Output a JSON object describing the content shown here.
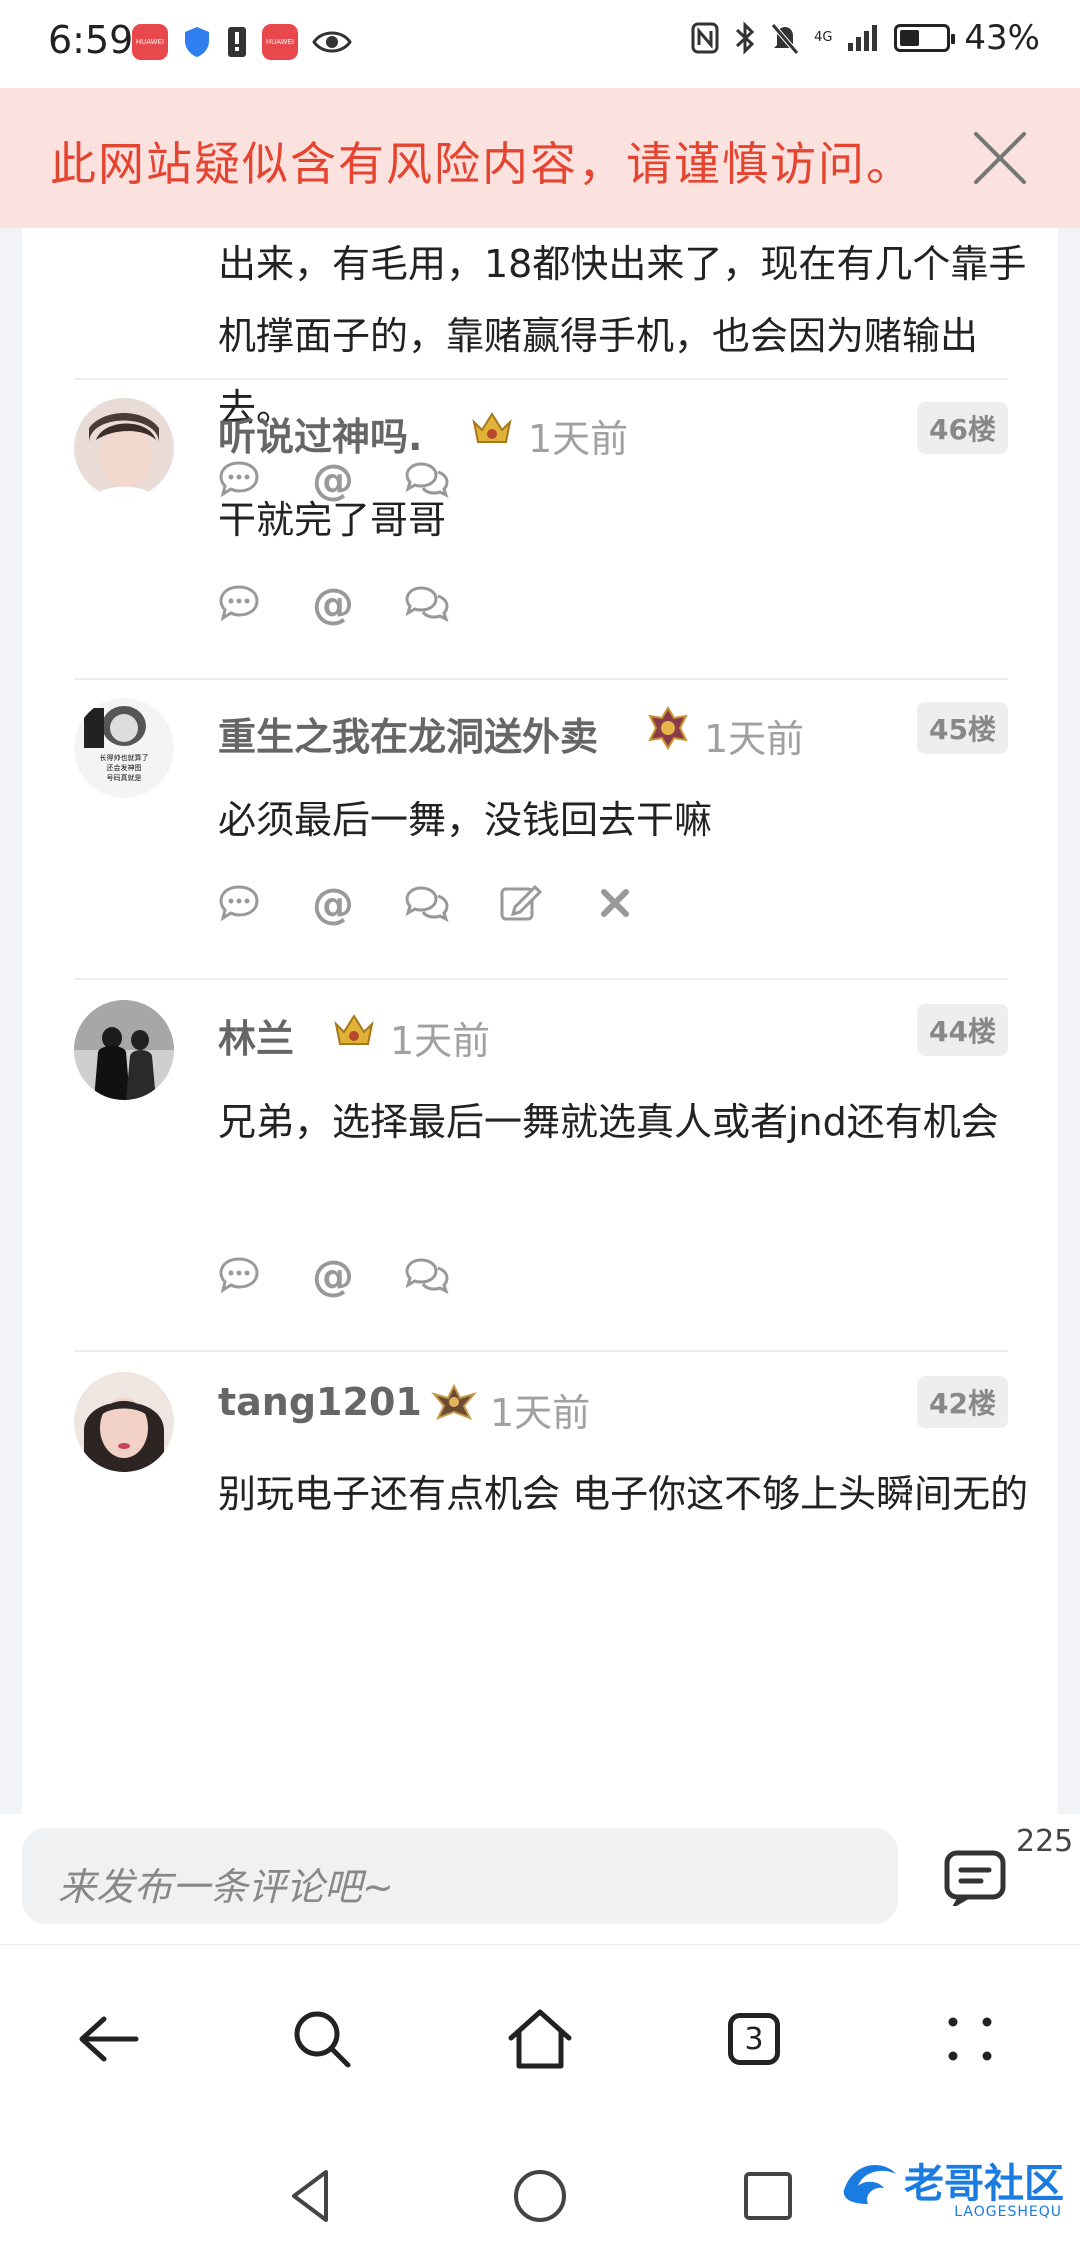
{
  "status_bar": {
    "time": "6:59",
    "battery": "43%",
    "battery_level": 0.43,
    "huawei_label": "HUAWEI",
    "network_label": "4G"
  },
  "warning": {
    "text": "此网站疑似含有风险内容，请谨慎访问。"
  },
  "prev_comment": {
    "text": "出来，有毛用，18都快出来了，现在有几个靠手机撑面子的，靠赌赢得手机，也会因为赌输出去。"
  },
  "comments": [
    {
      "username": "听说过神吗.",
      "time": "1天前",
      "floor": "46楼",
      "text": "干就完了哥哥"
    },
    {
      "username": "重生之我在龙洞送外卖",
      "time": "1天前",
      "floor": "45楼",
      "text": "必须最后一舞，没钱回去干嘛",
      "avatar_text": "长得帅也就算了 还会发神图 号码真就是"
    },
    {
      "username": "林兰",
      "time": "1天前",
      "floor": "44楼",
      "text": "兄弟，选择最后一舞就选真人或者jnd还有机会"
    },
    {
      "username": "tang1201",
      "time": "1天前",
      "floor": "42楼",
      "text": "别玩电子还有点机会  电子你这不够上头瞬间无的"
    }
  ],
  "comment_bar": {
    "placeholder": "来发布一条评论吧~",
    "count": "225"
  },
  "browser_nav": {
    "tab_count": "3"
  },
  "watermark": {
    "text": "老哥社区",
    "sub": "LAOGESHEQU"
  },
  "icons": {
    "reply": "speech-bubble-icon",
    "mention": "at-icon",
    "discuss": "double-bubble-icon",
    "edit": "edit-icon",
    "delete": "close-icon"
  },
  "colors": {
    "warning_bg": "#fbe2df",
    "warning_text": "#e54430",
    "username": "#666666",
    "time": "#a0a0a0"
  }
}
